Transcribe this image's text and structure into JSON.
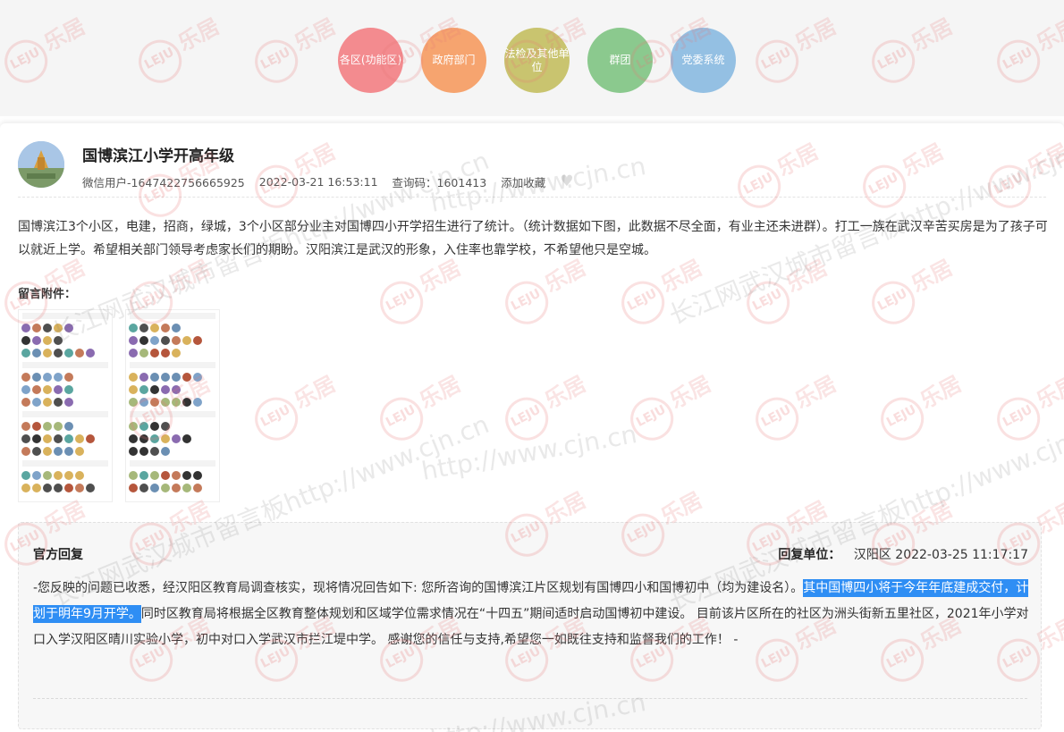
{
  "categories": [
    {
      "label": "各区(功能区)",
      "color": "#f38b8f"
    },
    {
      "label": "政府部门",
      "color": "#f6a46f"
    },
    {
      "label": "法检及其他单位",
      "color": "#c9c46f"
    },
    {
      "label": "群团",
      "color": "#8bc98e"
    },
    {
      "label": "党委系统",
      "color": "#94c0e3"
    }
  ],
  "post": {
    "title": "国博滨江小学开高年级",
    "author": "微信用户-1647422756665925",
    "datetime": "2022-03-21 16:53:11",
    "query_code": "查询码：1601413",
    "favorite_label": "添加收藏",
    "content": "国博滨江3个小区，电建，招商，绿城，3个小区部分业主对国博四小开学招生进行了统计。（统计数据如下图，此数据不尽全面，有业主还未进群）。打工一族在武汉辛苦买房是为了孩子可以就近上学。希望相关部门领导考虑家长们的期盼。汉阳滨江是武汉的形象，入住率也靠学校，不希望他只是空城。",
    "attachments_label": "留言附件："
  },
  "reply": {
    "title": "官方回复",
    "unit_label": "回复单位：",
    "unit": "汉阳区",
    "datetime": "2022-03-25 11:17:17",
    "body_before": "-您反映的问题已收悉，经汉阳区教育局调查核实，现将情况回告如下: 您所咨询的国博滨江片区规划有国博四小和国博初中（均为建设名）。",
    "body_highlight": "其中国博四小将于今年年底建成交付，计划于明年9月开学。",
    "body_after": "同时区教育局将根据全区教育整体规划和区域学位需求情况在“十四五”期间适时启动国博初中建设。 目前该片区所在的社区为洲头街新五里社区，2021年小学对口入学汉阳区晴川实验小学，初中对口入学武汉市拦江堤中学。 感谢您的信任与支持,希望您一如既往支持和监督我们的工作！ -"
  },
  "watermark": {
    "logo_text": "乐居",
    "logo_badge": "LEJU",
    "text": "长江网武汉城市留言板http://www.cjn.cn",
    "url": "http://www.cjn.cn"
  }
}
